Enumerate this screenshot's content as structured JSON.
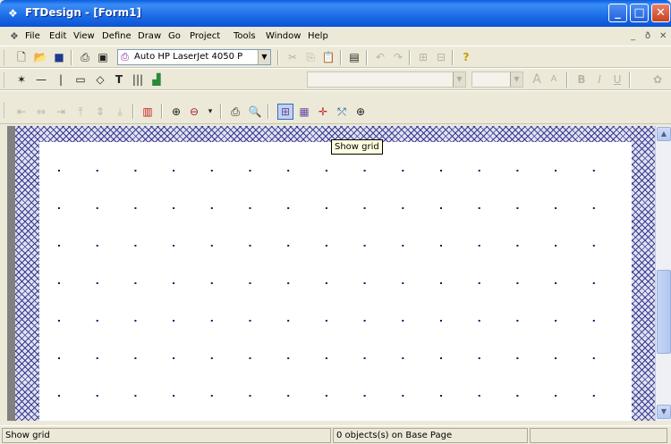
{
  "window": {
    "title": "FTDesign - [Form1]",
    "min_glyph": "_",
    "max_glyph": "□",
    "close_glyph": "✕"
  },
  "menu": {
    "items": [
      "File",
      "Edit",
      "View",
      "Define",
      "Draw",
      "Go",
      "Project",
      "Tools",
      "Window",
      "Help"
    ],
    "mdi_min": "_",
    "mdi_restore": "ð",
    "mdi_close": "✕"
  },
  "toolbar1": {
    "printer_value": "Auto HP LaserJet 4050 P",
    "help_icon": "?"
  },
  "toolbar2": {
    "text_tool": "T",
    "font_grow": "A",
    "font_shrink": "A",
    "bold": "B",
    "italic": "I",
    "underline": "U"
  },
  "tooltip": {
    "text": "Show grid"
  },
  "statusbar": {
    "message": "Show grid",
    "objects": "0 objects(s) on Base Page"
  },
  "colors": {
    "titlebar": "#0a53d6",
    "grid_dot": "#1a1a6a",
    "hatch": "#3b3b90"
  }
}
